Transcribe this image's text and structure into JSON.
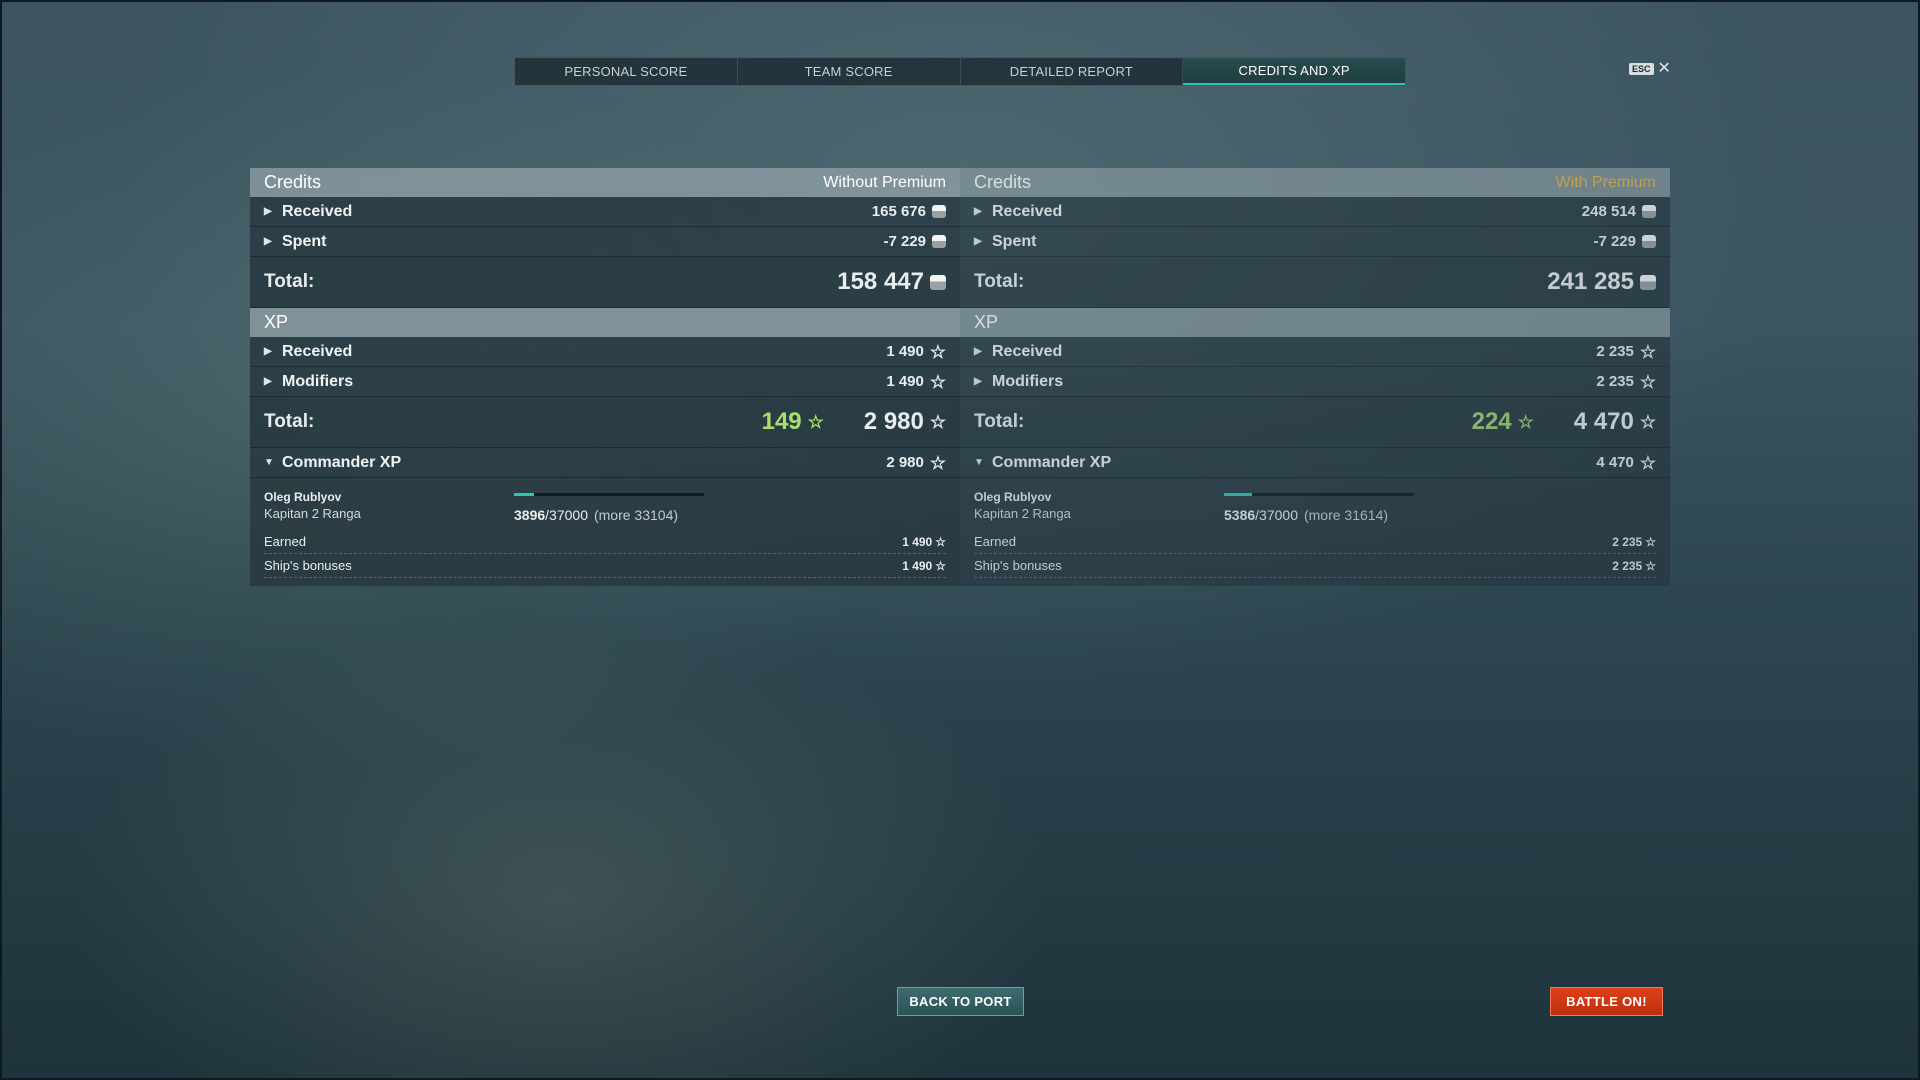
{
  "tabs": [
    {
      "label": "PERSONAL SCORE",
      "active": false
    },
    {
      "label": "TEAM SCORE",
      "active": false
    },
    {
      "label": "DETAILED REPORT",
      "active": false
    },
    {
      "label": "CREDITS AND XP",
      "active": true
    }
  ],
  "esc_label": "ESC",
  "left": {
    "credits_title": "Credits",
    "premium_label": "Without Premium",
    "credits_received_label": "Received",
    "credits_received": "165 676",
    "credits_spent_label": "Spent",
    "credits_spent": "-7 229",
    "credits_total_label": "Total:",
    "credits_total": "158 447",
    "xp_title": "XP",
    "xp_received_label": "Received",
    "xp_received": "1 490",
    "xp_modifiers_label": "Modifiers",
    "xp_modifiers": "1 490",
    "xp_total_label": "Total:",
    "xp_total_free": "149",
    "xp_total": "2 980",
    "commander_label": "Commander XP",
    "commander_xp": "2 980",
    "commander_name": "Oleg Rublyov",
    "commander_rank": "Kapitan 2 Ranga",
    "commander_progress_current": "3896",
    "commander_progress_max": "/37000",
    "commander_progress_more": "(more 33104)",
    "commander_progress_fraction": 0.105,
    "earned_label": "Earned",
    "earned": "1 490",
    "ship_bonus_label": "Ship's bonuses",
    "ship_bonus": "1 490"
  },
  "right": {
    "credits_title": "Credits",
    "premium_label": "With Premium",
    "credits_received_label": "Received",
    "credits_received": "248 514",
    "credits_spent_label": "Spent",
    "credits_spent": "-7 229",
    "credits_total_label": "Total:",
    "credits_total": "241 285",
    "xp_title": "XP",
    "xp_received_label": "Received",
    "xp_received": "2 235",
    "xp_modifiers_label": "Modifiers",
    "xp_modifiers": "2 235",
    "xp_total_label": "Total:",
    "xp_total_free": "224",
    "xp_total": "4 470",
    "commander_label": "Commander XP",
    "commander_xp": "4 470",
    "commander_name": "Oleg Rublyov",
    "commander_rank": "Kapitan 2 Ranga",
    "commander_progress_current": "5386",
    "commander_progress_max": "/37000",
    "commander_progress_more": "(more 31614)",
    "commander_progress_fraction": 0.146,
    "earned_label": "Earned",
    "earned": "2 235",
    "ship_bonus_label": "Ship's bonuses",
    "ship_bonus": "2 235"
  },
  "buttons": {
    "back_to_port": "BACK TO PORT",
    "battle_on": "BATTLE ON!"
  },
  "colors": {
    "accent_teal": "#29c7b6",
    "premium_gold": "#e3b34b",
    "free_xp_green": "#a8e06a",
    "battle_red": "#d63a16"
  }
}
